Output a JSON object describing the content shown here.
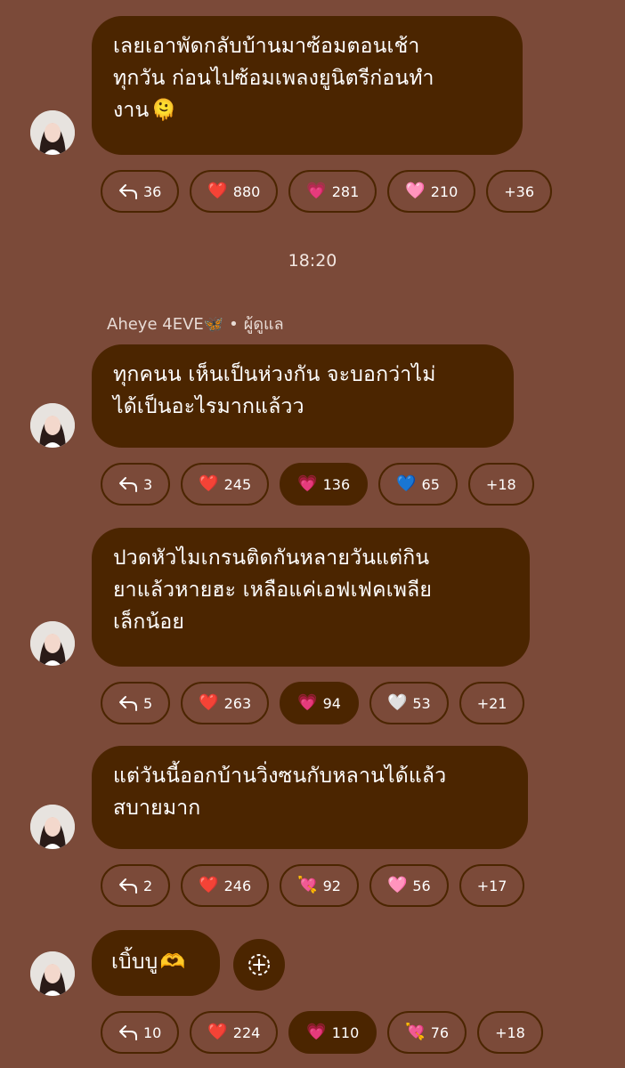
{
  "timestamp": "18:20",
  "sender": {
    "name": "Aheye 4EVE🦋",
    "separator": "•",
    "role": "ผู้ดูแล"
  },
  "messages": [
    {
      "lines": [
        "เลยเอาพัดกลับบ้านมาซ้อมตอนเช้า",
        "ทุกวัน ก่อนไปซ้อมเพลงยูนิตรีก่อนทำ",
        "งาน"
      ],
      "emoji": "🫠",
      "reactions": [
        {
          "type": "reply",
          "label": "36",
          "selected": false
        },
        {
          "icon": "❤️",
          "label": "880",
          "selected": false
        },
        {
          "icon": "💗",
          "label": "281",
          "selected": false
        },
        {
          "icon": "🩷",
          "label": "210",
          "selected": false
        },
        {
          "type": "more",
          "label": "+36",
          "selected": false
        }
      ]
    },
    {
      "lines": [
        "ทุกคนน เห็นเป็นห่วงกัน จะบอกว่าไม่",
        "ได้เป็นอะไรมากแล้วว"
      ],
      "emoji": "",
      "reactions": [
        {
          "type": "reply",
          "label": "3",
          "selected": false
        },
        {
          "icon": "❤️",
          "label": "245",
          "selected": false
        },
        {
          "icon": "💗",
          "label": "136",
          "selected": true
        },
        {
          "icon": "💙",
          "label": "65",
          "selected": false
        },
        {
          "type": "more",
          "label": "+18",
          "selected": false
        }
      ]
    },
    {
      "lines": [
        "ปวดหัวไมเกรนติดกันหลายวันแต่กิน",
        "ยาแล้วหายฮะ เหลือแค่เอฟเฟคเพลีย",
        "เล็กน้อย"
      ],
      "emoji": "",
      "reactions": [
        {
          "type": "reply",
          "label": "5",
          "selected": false
        },
        {
          "icon": "❤️",
          "label": "263",
          "selected": false
        },
        {
          "icon": "💗",
          "label": "94",
          "selected": true
        },
        {
          "icon": "🤍",
          "label": "53",
          "selected": false
        },
        {
          "type": "more",
          "label": "+21",
          "selected": false
        }
      ]
    },
    {
      "lines": [
        "แต่วันนี้ออกบ้านวิ่งซนกับหลานได้แล้ว",
        "สบายมาก"
      ],
      "emoji": "",
      "reactions": [
        {
          "type": "reply",
          "label": "2",
          "selected": false
        },
        {
          "icon": "❤️",
          "label": "246",
          "selected": false
        },
        {
          "icon": "💘",
          "label": "92",
          "selected": false
        },
        {
          "icon": "🩷",
          "label": "56",
          "selected": false
        },
        {
          "type": "more",
          "label": "+17",
          "selected": false
        }
      ]
    },
    {
      "lines": [
        "เบิ้บบู"
      ],
      "emoji": "🫶",
      "reactions": [
        {
          "type": "reply",
          "label": "10",
          "selected": false
        },
        {
          "icon": "❤️",
          "label": "224",
          "selected": false
        },
        {
          "icon": "💗",
          "label": "110",
          "selected": true
        },
        {
          "icon": "💘",
          "label": "76",
          "selected": false
        },
        {
          "type": "more",
          "label": "+18",
          "selected": false
        }
      ]
    }
  ],
  "colors": {
    "background": "#7b4a39",
    "bubble": "#4b2500",
    "text": "#ffffff"
  }
}
